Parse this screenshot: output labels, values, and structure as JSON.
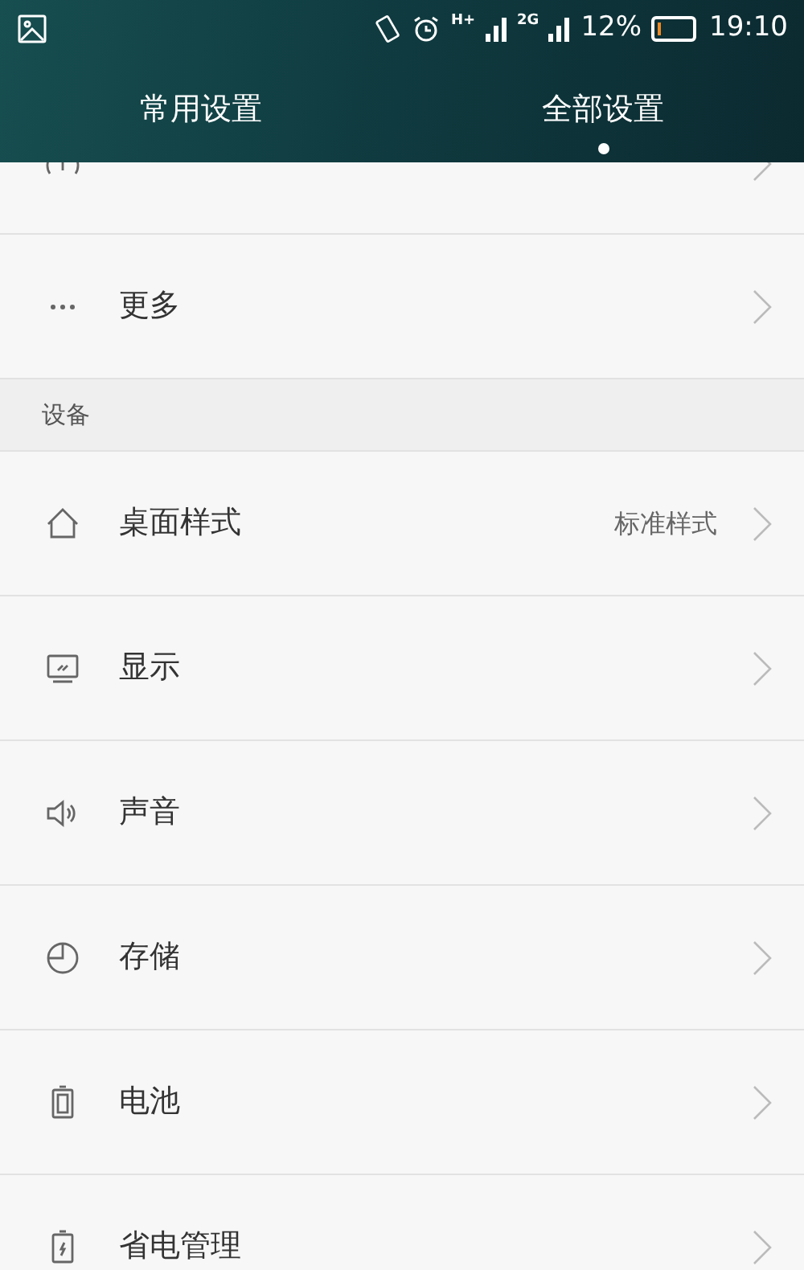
{
  "status_bar": {
    "network_1": "H+",
    "network_2": "2G",
    "battery_percent": "12%",
    "level": 0.12,
    "time": "19:10"
  },
  "tabs": [
    {
      "label": "常用设置",
      "selected": false
    },
    {
      "label": "全部设置",
      "selected": true
    }
  ],
  "groups": [
    {
      "items": [
        {
          "kind": "data",
          "clipped": true
        },
        {
          "label": "更多",
          "kind": "more"
        }
      ]
    },
    {
      "title": "设备",
      "items": [
        {
          "label": "桌面样式",
          "kind": "home",
          "value": "标准样式"
        },
        {
          "label": "显示",
          "kind": "display"
        },
        {
          "label": "声音",
          "kind": "sound"
        },
        {
          "label": "存储",
          "kind": "storage"
        },
        {
          "label": "电池",
          "kind": "battery"
        },
        {
          "label": "省电管理",
          "kind": "power_saving"
        }
      ]
    }
  ]
}
